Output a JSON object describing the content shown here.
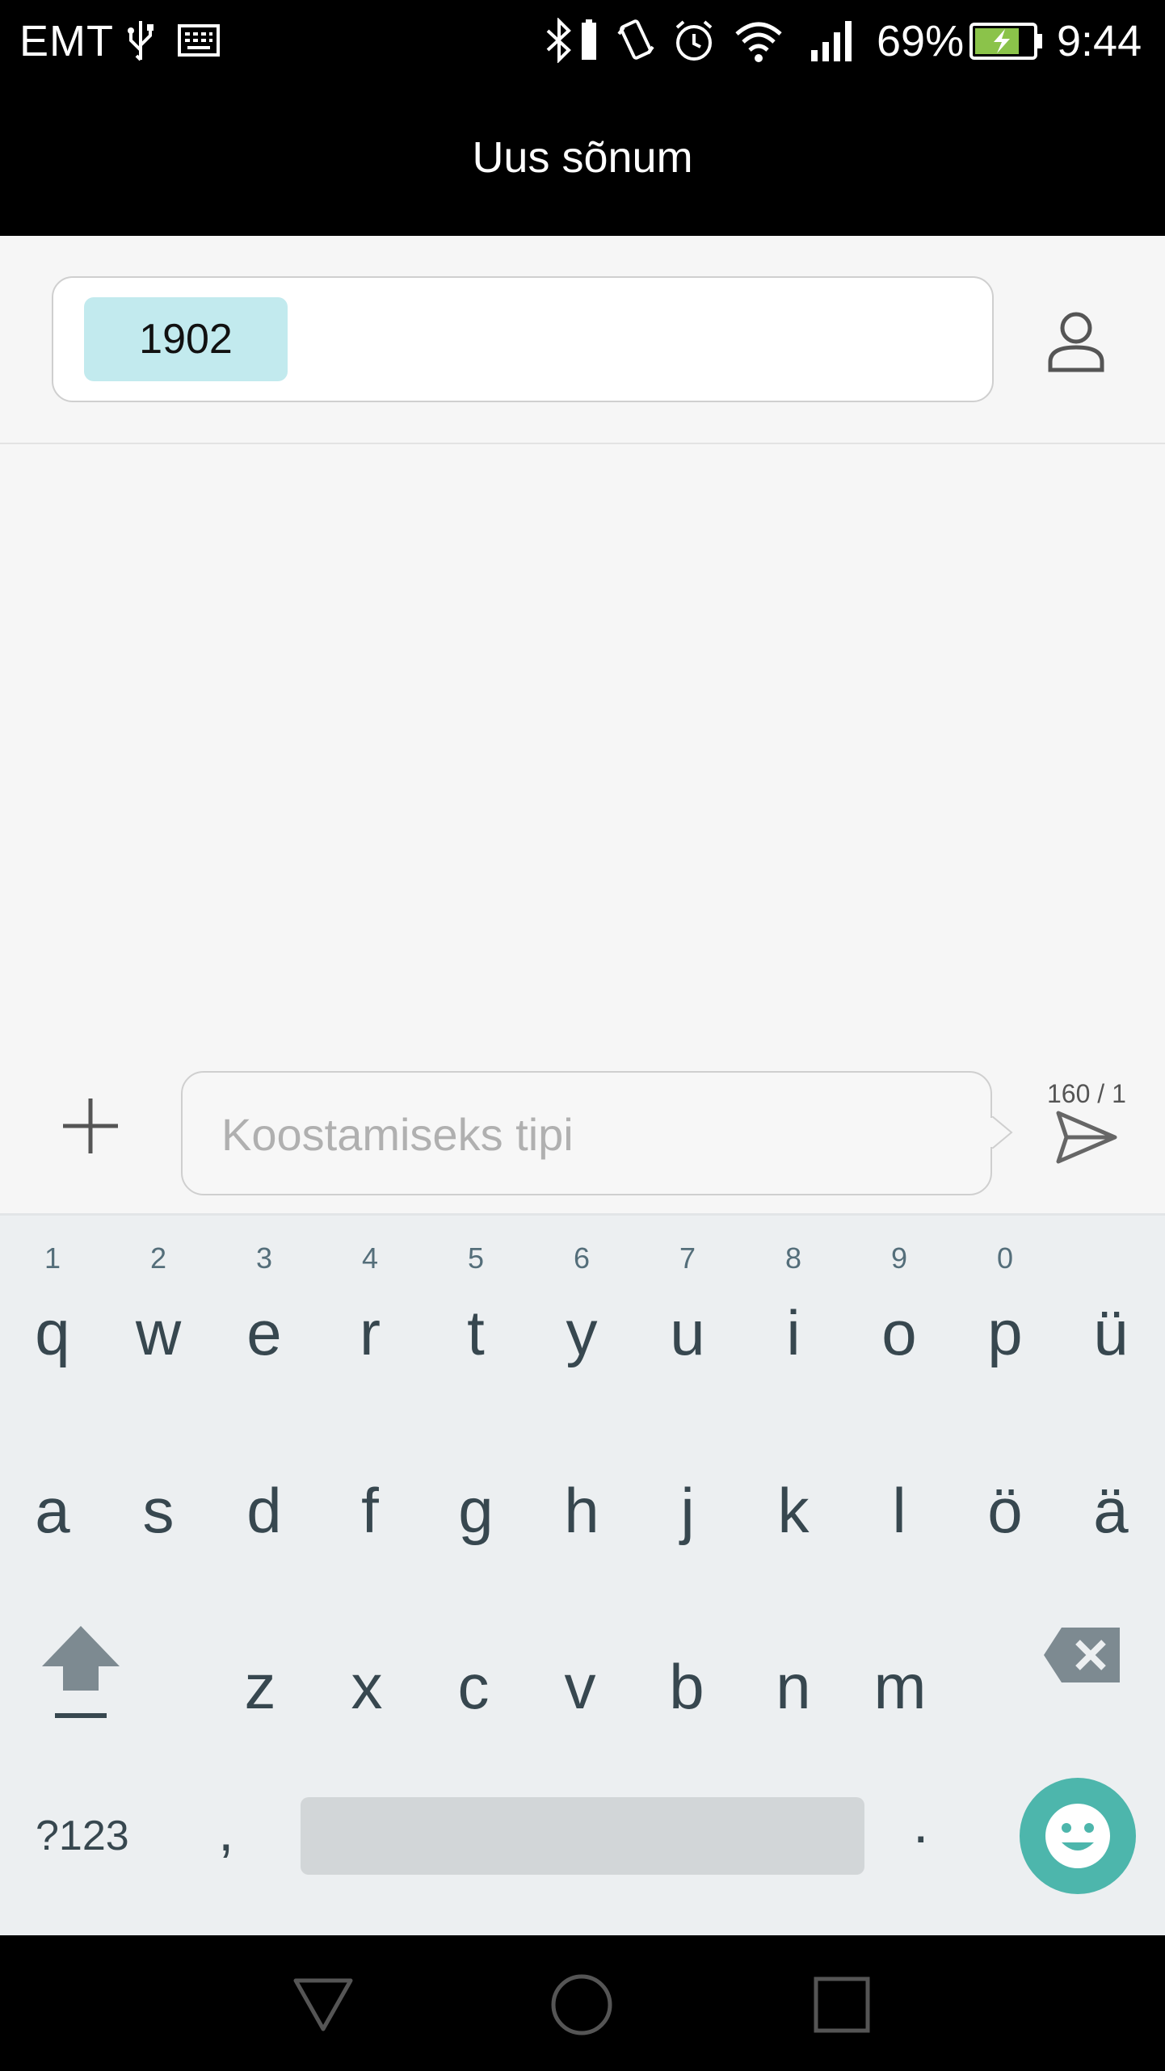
{
  "status_bar": {
    "carrier": "EMT",
    "battery_percent": "69%",
    "time": "9:44",
    "icons": [
      "usb-icon",
      "keyboard-icon",
      "bluetooth-icon",
      "vibrate-icon",
      "alarm-icon",
      "wifi-icon",
      "signal-icon",
      "battery-charging-icon"
    ]
  },
  "header": {
    "title": "Uus sõnum"
  },
  "recipient": {
    "chip": "1902"
  },
  "composer": {
    "placeholder": "Koostamiseks tipi",
    "char_counter": "160 / 1"
  },
  "keyboard": {
    "row1": [
      {
        "k": "q",
        "n": "1"
      },
      {
        "k": "w",
        "n": "2"
      },
      {
        "k": "e",
        "n": "3"
      },
      {
        "k": "r",
        "n": "4"
      },
      {
        "k": "t",
        "n": "5"
      },
      {
        "k": "y",
        "n": "6"
      },
      {
        "k": "u",
        "n": "7"
      },
      {
        "k": "i",
        "n": "8"
      },
      {
        "k": "o",
        "n": "9"
      },
      {
        "k": "p",
        "n": "0"
      },
      {
        "k": "ü",
        "n": ""
      }
    ],
    "row2": [
      "a",
      "s",
      "d",
      "f",
      "g",
      "h",
      "j",
      "k",
      "l",
      "ö",
      "ä"
    ],
    "row3": [
      "z",
      "x",
      "c",
      "v",
      "b",
      "n",
      "m"
    ],
    "symbols_label": "?123",
    "comma": ",",
    "period": "."
  },
  "colors": {
    "chip_bg": "#c2eaee",
    "emoji_button": "#4db6ac",
    "battery_fill": "#8bc34a"
  }
}
